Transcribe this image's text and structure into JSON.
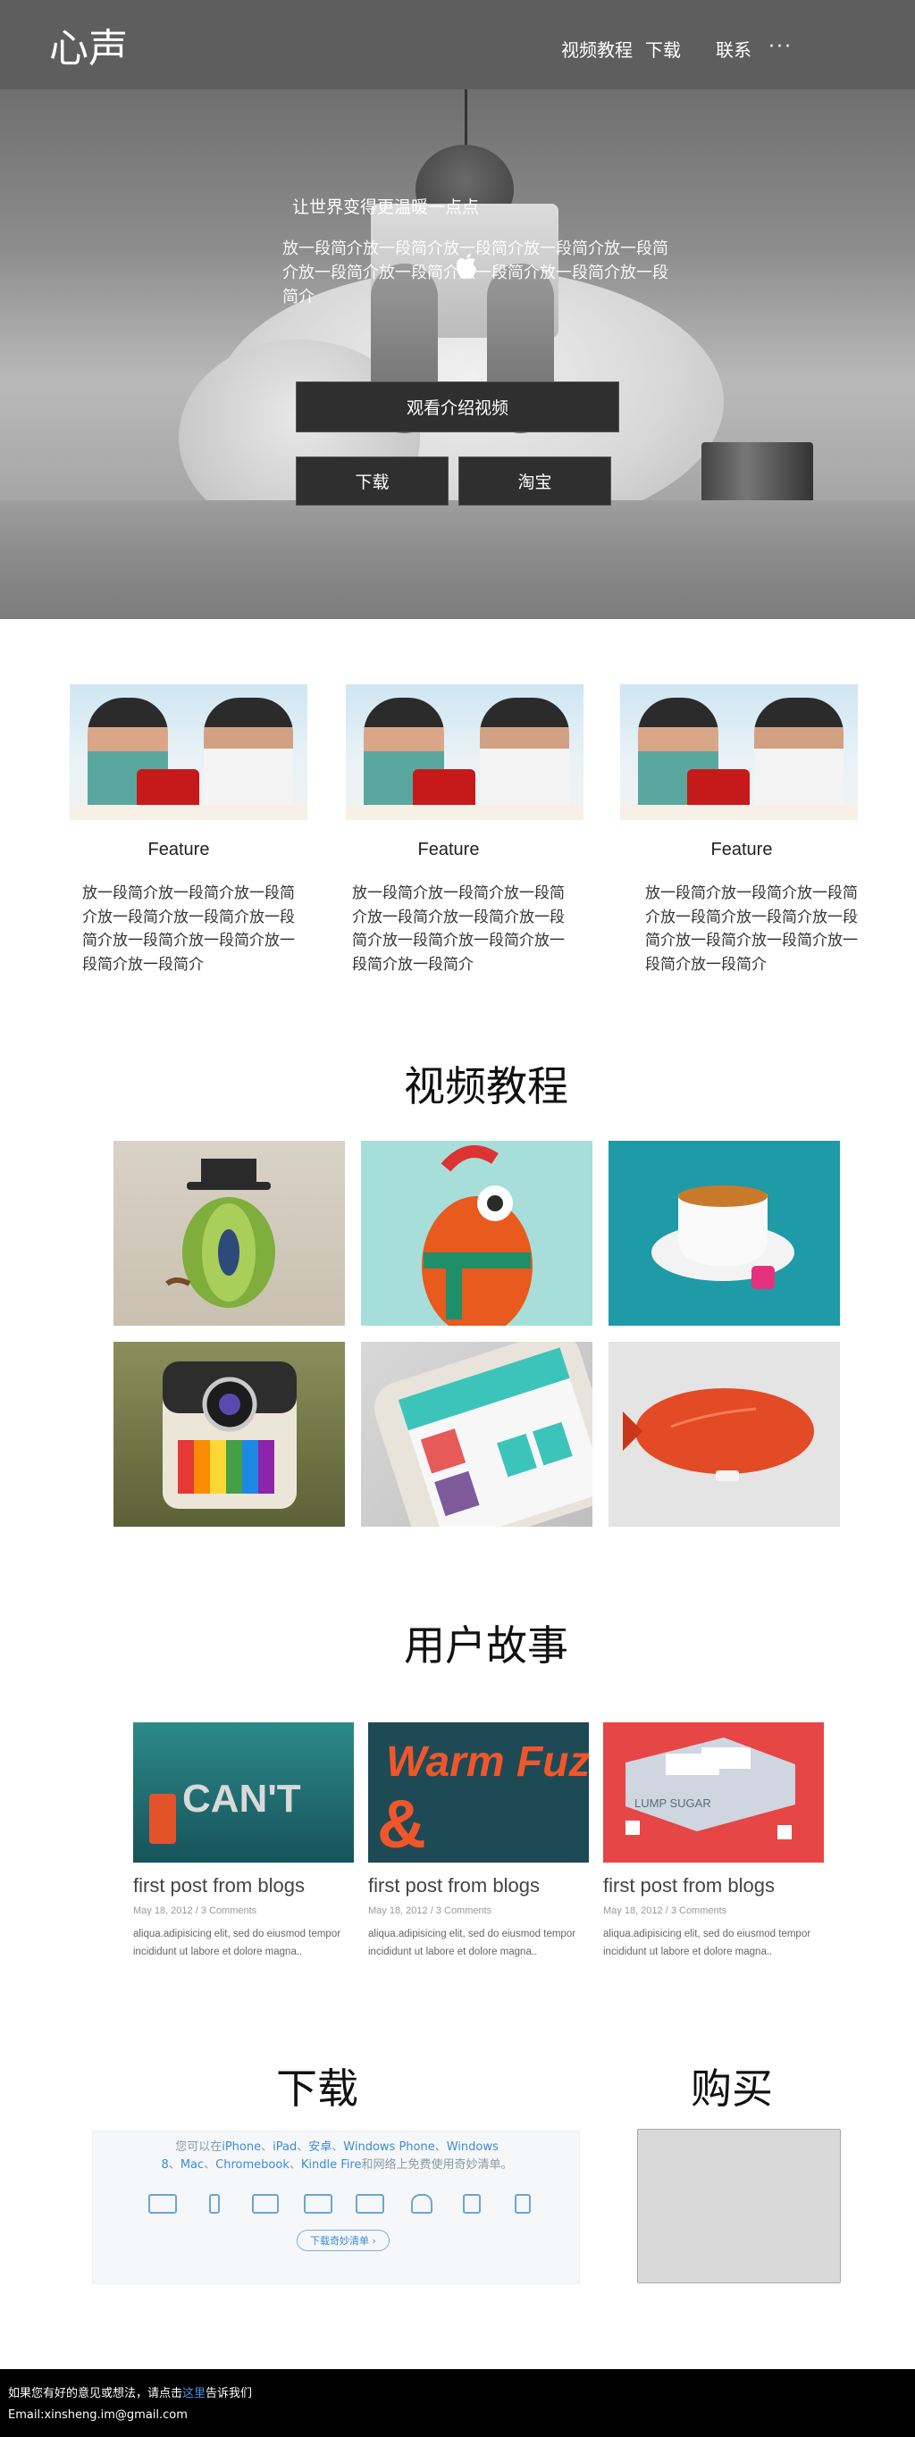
{
  "header": {
    "brand": "心声",
    "nav": [
      "视频教程",
      "下载",
      "联系"
    ],
    "more": "···"
  },
  "hero": {
    "title": "让世界变得更温暖一点点",
    "description": "放一段简介放一段简介放一段简介放一段简介放一段简介放一段简介放一段简介放一段简介放一段简介放一段简介",
    "watch_video_label": "观看介绍视频",
    "download_label": "下载",
    "taobao_label": "淘宝"
  },
  "features": [
    {
      "title": "Feature",
      "text": "放一段简介放一段简介放一段简介放一段简介放一段简介放一段简介放一段简介放一段简介放一段简介放一段简介"
    },
    {
      "title": "Feature",
      "text": "放一段简介放一段简介放一段简介放一段简介放一段简介放一段简介放一段简介放一段简介放一段简介放一段简介"
    },
    {
      "title": "Feature",
      "text": "放一段简介放一段简介放一段简介放一段简介放一段简介放一段简介放一段简介放一段简介放一段简介放一段简介"
    }
  ],
  "videos": {
    "title": "视频教程",
    "tiles": [
      "apple-gentleman-illustration",
      "red-monster-with-scarf-illustration",
      "tea-cup-illustration",
      "instant-camera-illustration",
      "phone-calendar-app-illustration",
      "red-blimp-illustration"
    ]
  },
  "stories": {
    "title": "用户故事",
    "items": [
      {
        "title": "first post from blogs",
        "meta": "May 18, 2012 / 3 Comments",
        "text": "aliqua.adipisicing elit, sed do eiusmod tempor incididunt ut labore et dolore magna.."
      },
      {
        "title": "first post from blogs",
        "meta": "May 18, 2012 / 3 Comments",
        "text": "aliqua.adipisicing elit, sed do eiusmod tempor incididunt ut labore et dolore magna.."
      },
      {
        "title": "first post from blogs",
        "meta": "May 18, 2012 / 3 Comments",
        "text": "aliqua.adipisicing elit, sed do eiusmod tempor incididunt ut labore et dolore magna.."
      }
    ],
    "image_text": [
      "CAN'T",
      "Warm Fuzzy",
      "LUMP SUGAR"
    ]
  },
  "download": {
    "title": "下载",
    "intro_prefix": "您可以在",
    "platforms_line1": [
      "iPhone",
      "iPad",
      "安卓",
      "Windows Phone",
      "Windows"
    ],
    "platforms_line2": [
      "8",
      "Mac",
      "Chromebook",
      "Kindle Fire"
    ],
    "intro_suffix": "和网络上免费使用奇妙清单。",
    "button_label": "下载奇妙清单 ›"
  },
  "buy": {
    "title": "购买"
  },
  "footer": {
    "line1_prefix": "如果您有好的意见或想法，请点击",
    "line1_link": "这里",
    "line1_suffix": "告诉我们",
    "email": "Email:xinsheng.im@gmail.com"
  },
  "colors": {
    "header_bg": "#5e5e5e",
    "button_bg": "#2f2f2f",
    "link_blue": "#3d8bd6",
    "footer_bg": "#000000"
  }
}
